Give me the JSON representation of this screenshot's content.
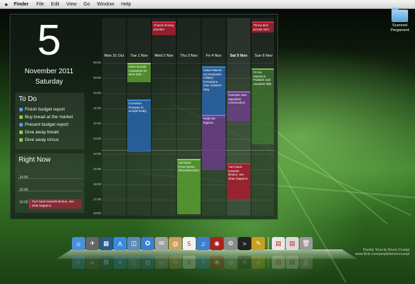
{
  "menubar": {
    "app": "Finder",
    "items": [
      "File",
      "Edit",
      "View",
      "Go",
      "Window",
      "Help"
    ]
  },
  "date": {
    "day": "5",
    "month_year": "November 2011",
    "weekday": "Saturday"
  },
  "todo": {
    "title": "To Do",
    "items": [
      {
        "label": "Finish budget report",
        "color": "#5aa0e0"
      },
      {
        "label": "Buy bread at the market",
        "color": "#8bd24a"
      },
      {
        "label": "Present budget report",
        "color": "#5aa0e0"
      },
      {
        "label": "Give away bread",
        "color": "#8bd24a"
      },
      {
        "label": "Give away circus",
        "color": "#8bd24a"
      }
    ]
  },
  "right_now": {
    "title": "Right Now",
    "times": [
      "14:00",
      "15:00",
      "16:00"
    ],
    "event": "Turn back towards Brutus, see what happens"
  },
  "calendar": {
    "days": [
      "Mon 31 Oct",
      "Tue 1 Nov",
      "Wed 2 Nov",
      "Thu 3 Nov",
      "Fri 4 Nov",
      "Sat 5 Nov",
      "Sun 6 Nov"
    ],
    "hours": [
      "08:00",
      "09:00",
      "10:00",
      "11:00",
      "12:00",
      "13:00",
      "14:00",
      "15:00",
      "16:00",
      "17:00",
      "18:00"
    ],
    "events": {
      "chariot": "Chariot driving practice",
      "dice": "Throw dice across river",
      "senate": "Meet Senate Caesperis for wine and ...",
      "convince": "Convince Pompey to accept treaty",
      "gaius": "Gaius Marius un-manipular military formations",
      "gaius_note": "One Column! Way",
      "circus": "Circus Maximus",
      "circus_note": "Palatine and Aventine hills",
      "oversee": "Oversee new aqueduct construction",
      "rally": "Rally the legions",
      "getback": "Get Back From Rome Reconstruction",
      "turnback": "Turn back towards Brutus, see what happens"
    }
  },
  "desktop_icon": {
    "label": "Scanned Pergament"
  },
  "credit": {
    "line1": "Parsita Terra by Bruno Crumpl",
    "line2": "www.flickr.com/people/brunocrumpl"
  },
  "dock": {
    "icons": [
      {
        "name": "finder-icon",
        "color": "#4a90d9",
        "glyph": "☺"
      },
      {
        "name": "rocket-icon",
        "color": "#666",
        "glyph": "✈"
      },
      {
        "name": "photo-icon",
        "color": "#2b5a8a",
        "glyph": "▦"
      },
      {
        "name": "appstore-icon",
        "color": "#3a8ae0",
        "glyph": "A"
      },
      {
        "name": "preview-icon",
        "color": "#5d8bb8",
        "glyph": "◫"
      },
      {
        "name": "safari-icon",
        "color": "#3b7fd0",
        "glyph": "✪"
      },
      {
        "name": "mail-icon",
        "color": "#a0a0a0",
        "glyph": "✉"
      },
      {
        "name": "contacts-icon",
        "color": "#c8a060",
        "glyph": "@"
      },
      {
        "name": "ical-icon",
        "color": "#f2f2f2",
        "glyph": "5"
      },
      {
        "name": "itunes-icon",
        "color": "#3b7fd0",
        "glyph": "♫"
      },
      {
        "name": "photobooth-icon",
        "color": "#a22",
        "glyph": "◉"
      },
      {
        "name": "preferences-icon",
        "color": "#8a8a8a",
        "glyph": "⚙"
      },
      {
        "name": "terminal-icon",
        "color": "#222",
        "glyph": ">"
      },
      {
        "name": "utility-icon",
        "color": "#caa020",
        "glyph": "✎"
      }
    ],
    "stacks": [
      {
        "name": "document-icon",
        "color": "#e8e8e8",
        "glyph": "▤"
      },
      {
        "name": "downloads-icon",
        "color": "#dadada",
        "glyph": "▤"
      },
      {
        "name": "trash-icon",
        "color": "#9a9a9a",
        "glyph": "🗑"
      }
    ]
  }
}
